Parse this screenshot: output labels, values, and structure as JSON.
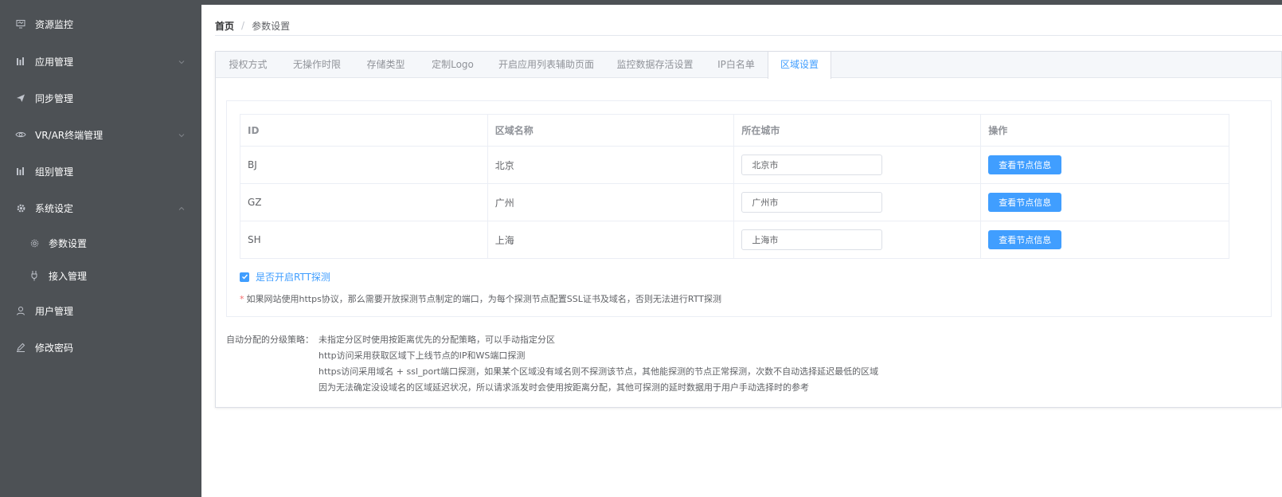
{
  "sidebar": {
    "items": [
      {
        "label": "资源监控",
        "icon": "monitor-icon"
      },
      {
        "label": "应用管理",
        "icon": "bar-chart-icon",
        "chevron": "down"
      },
      {
        "label": "同步管理",
        "icon": "send-icon"
      },
      {
        "label": "VR/AR终端管理",
        "icon": "eye-icon",
        "chevron": "down"
      },
      {
        "label": "组别管理",
        "icon": "bar-chart-icon"
      },
      {
        "label": "系统设定",
        "icon": "gear-icon",
        "chevron": "up"
      },
      {
        "label": "参数设置",
        "icon": "gear-icon",
        "sub": true
      },
      {
        "label": "接入管理",
        "icon": "plug-icon",
        "sub": true
      },
      {
        "label": "用户管理",
        "icon": "user-icon"
      },
      {
        "label": "修改密码",
        "icon": "edit-icon"
      }
    ]
  },
  "breadcrumb": {
    "home": "首页",
    "separator": "/",
    "current": "参数设置"
  },
  "tabs": [
    {
      "label": "授权方式"
    },
    {
      "label": "无操作时限"
    },
    {
      "label": "存储类型"
    },
    {
      "label": "定制Logo"
    },
    {
      "label": "开启应用列表辅助页面"
    },
    {
      "label": "监控数据存活设置"
    },
    {
      "label": "IP白名单"
    },
    {
      "label": "区域设置",
      "active": true
    }
  ],
  "table": {
    "headers": [
      "ID",
      "区域名称",
      "所在城市",
      "操作"
    ],
    "rows": [
      {
        "id": "BJ",
        "name": "北京",
        "city": "北京市",
        "action": "查看节点信息"
      },
      {
        "id": "GZ",
        "name": "广州",
        "city": "广州市",
        "action": "查看节点信息"
      },
      {
        "id": "SH",
        "name": "上海",
        "city": "上海市",
        "action": "查看节点信息"
      }
    ]
  },
  "rtt": {
    "label": "是否开启RTT探测",
    "checked": true
  },
  "note": {
    "star": "*",
    "text": "如果网站使用https协议，那么需要开放探测节点制定的端口，为每个探测节点配置SSL证书及域名，否则无法进行RTT探测"
  },
  "policy": {
    "label": "自动分配的分级策略：",
    "lines": [
      "未指定分区时使用按距离优先的分配策略，可以手动指定分区",
      "http访问采用获取区域下上线节点的IP和WS端口探测",
      "https访问采用域名 + ssl_port端口探测，如果某个区域没有域名则不探测该节点，其他能探测的节点正常探测，次数不自动选择延迟最低的区域",
      "因为无法确定没设域名的区域延迟状况，所以请求派发时会使用按距离分配，其他可探测的延时数据用于用户手动选择时的参考"
    ]
  },
  "colors": {
    "sidebar_bg": "#4d5155",
    "accent": "#409eff",
    "required": "#f56c6c"
  }
}
